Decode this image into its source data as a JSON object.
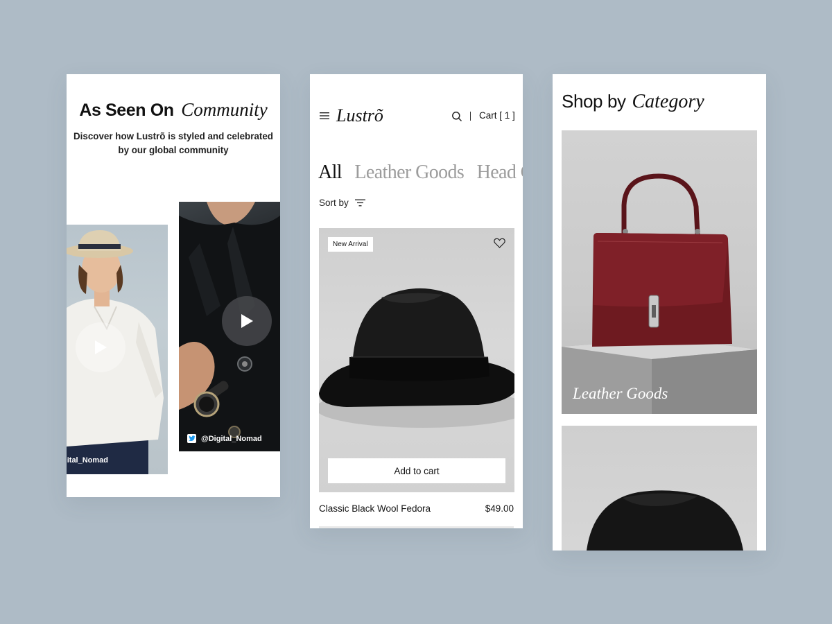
{
  "colors": {
    "background": "#aebbc6",
    "card": "#ffffff",
    "text": "#111111",
    "muted_tab": "#9c9c9c",
    "bag_accent": "#7a1e24"
  },
  "community": {
    "title_bold": "As Seen On",
    "title_italic": "Community",
    "subtitle": "Discover how Lustrõ is styled and celebrated by our global community",
    "posts": [
      {
        "handle": "@Digital_Nomad",
        "visible_handle": "gital_Nomad",
        "icon": "play-icon"
      },
      {
        "handle": "@Digital_Nomad",
        "social_icon": "twitter-icon",
        "icon": "play-icon"
      }
    ]
  },
  "shop": {
    "brand": "Lustrõ",
    "cart_label": "Cart [ 1 ]",
    "tabs": [
      {
        "label": "All",
        "active": true
      },
      {
        "label": "Leather Goods",
        "active": false
      },
      {
        "label": "Head Gears",
        "active": false
      }
    ],
    "sort_label": "Sort by",
    "product": {
      "badge": "New Arrival",
      "add_to_cart": "Add to cart",
      "name": "Classic Black Wool Fedora",
      "price": "$49.00"
    }
  },
  "categories": {
    "title_plain": "Shop by",
    "title_italic": "Category",
    "items": [
      {
        "label": "Leather Goods"
      },
      {
        "label": ""
      }
    ]
  }
}
